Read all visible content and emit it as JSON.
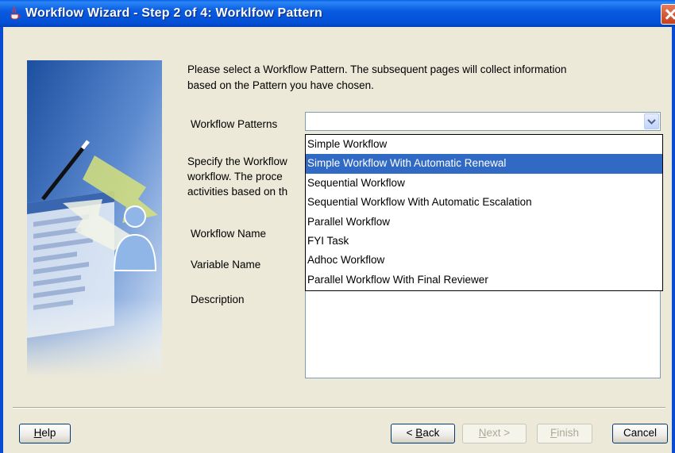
{
  "window": {
    "title": "Workflow Wizard - Step 2 of 4: Worklfow Pattern"
  },
  "intro": {
    "line1": "Please select a Workflow Pattern. The subsequent pages will collect information",
    "line2": "based on the Pattern you have chosen."
  },
  "form": {
    "patterns_label": "Workflow Patterns",
    "patterns_value": "",
    "specify_line1": "Specify the Workflow",
    "specify_line2": "workflow. The proce",
    "specify_line3": "activities based on th",
    "workflow_name_label": "Workflow Name",
    "variable_name_label": "Variable Name",
    "description_label": "Description"
  },
  "dropdown": {
    "selected": "Simple Workflow With Automatic Renewal",
    "options": [
      "Simple Workflow",
      "Simple Workflow With Automatic Renewal",
      "Sequential Workflow",
      "Sequential Workflow With Automatic Escalation",
      "Parallel Workflow",
      "FYI Task",
      "Adhoc Workflow",
      "Parallel Workflow With Final Reviewer"
    ]
  },
  "buttons": {
    "help_m": "H",
    "help_r": "elp",
    "back_l": "< ",
    "back_m": "B",
    "back_r": "ack",
    "next_m": "N",
    "next_r": "ext >",
    "finish_m": "F",
    "finish_r": "inish",
    "cancel": "Cancel"
  },
  "colors": {
    "titlebar": "#0A5BE0",
    "selection": "#316AC5",
    "dialog_bg": "#ECE9D8"
  },
  "icons": {
    "app": "java-cup-icon",
    "close": "close-icon",
    "combo": "chevron-down-icon",
    "banner": "wizard-banner-illustration"
  }
}
